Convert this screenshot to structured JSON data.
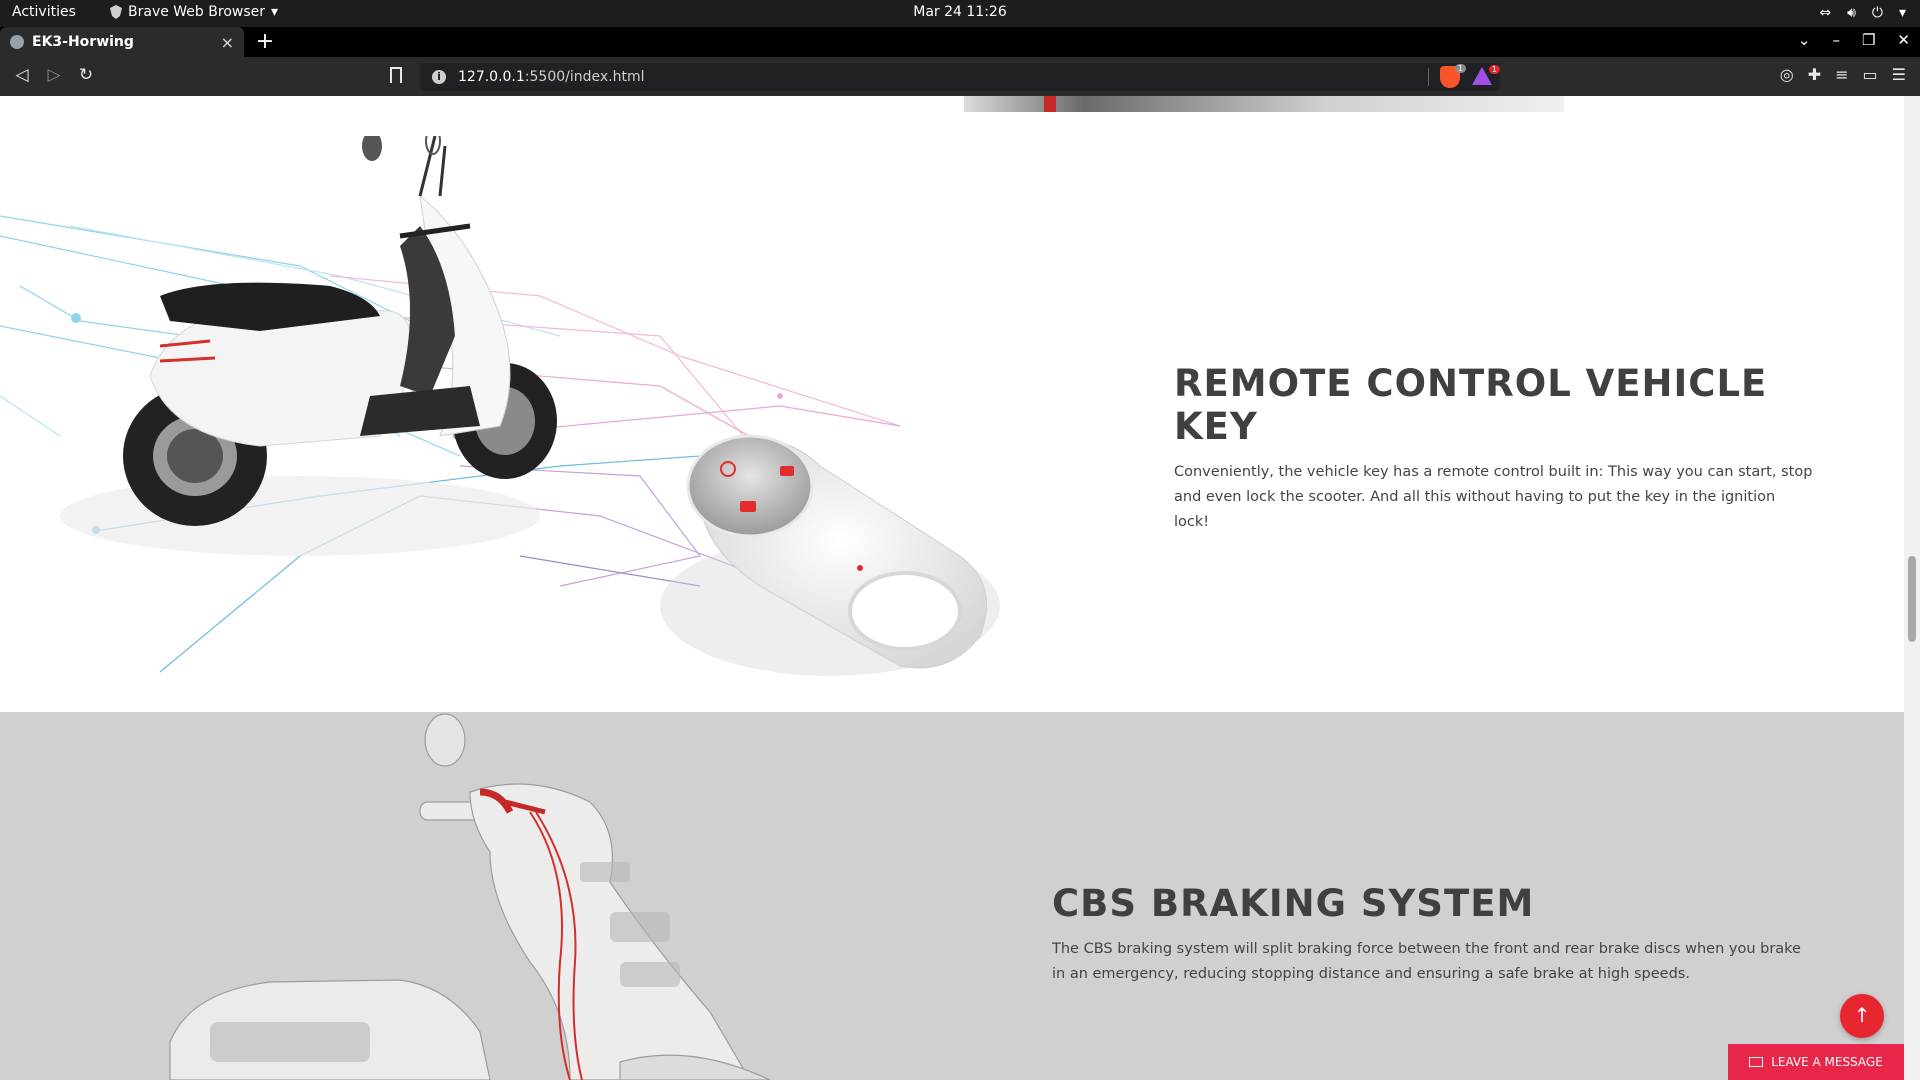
{
  "system_bar": {
    "activities": "Activities",
    "app_name": "Brave Web Browser",
    "clock": "Mar 24  11:26"
  },
  "browser": {
    "tab_title": "EK3-Horwing",
    "tab_close": "×",
    "new_tab": "+",
    "url_host": "127.0.0.1",
    "url_rest": ":5500/index.html",
    "shield_count": "1",
    "rewards_count": "1"
  },
  "features": [
    {
      "title": "REMOTE CONTROL VEHICLE KEY",
      "body": "Conveniently, the vehicle key has a remote control built in: This way you can start, stop and even lock the scooter. And all this without having to put the key in the ignition lock!"
    },
    {
      "title": "CBS BRAKING SYSTEM",
      "body": "The CBS braking system will split braking force between the front and rear brake discs when you brake in an emergency, reducing stopping distance and ensuring a safe brake at high speeds."
    }
  ],
  "widgets": {
    "back_to_top": "↑",
    "leave_message": "LEAVE A MESSAGE"
  },
  "colors": {
    "accent_red": "#e8262f",
    "section_gray": "#d0d0d0",
    "heading": "#404040"
  }
}
